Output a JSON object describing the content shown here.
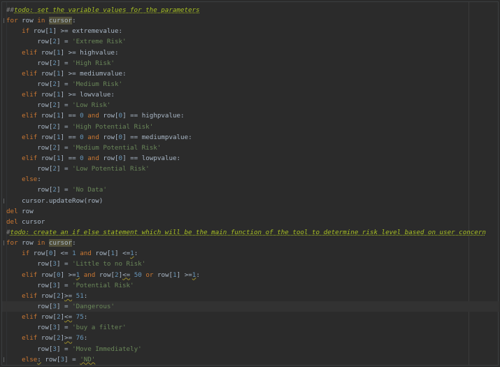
{
  "editor": {
    "lines": [
      [
        [
          "cmt",
          "##"
        ],
        [
          "todo",
          "todo: set the variable values for the parameters"
        ]
      ],
      [
        [
          "kw",
          "for "
        ],
        [
          "id",
          "row "
        ],
        [
          "kw",
          "in "
        ],
        [
          "hl",
          "cursor"
        ],
        [
          "id",
          ":"
        ]
      ],
      [
        [
          "id",
          "    "
        ],
        [
          "kw",
          "if "
        ],
        [
          "id",
          "row["
        ],
        [
          "num",
          "1"
        ],
        [
          "id",
          "] >= extremevalue:"
        ]
      ],
      [
        [
          "id",
          "        row["
        ],
        [
          "num",
          "2"
        ],
        [
          "id",
          "] = "
        ],
        [
          "str",
          "'Extreme Risk'"
        ]
      ],
      [
        [
          "id",
          "    "
        ],
        [
          "kw",
          "elif "
        ],
        [
          "id",
          "row["
        ],
        [
          "num",
          "1"
        ],
        [
          "id",
          "] >= highvalue:"
        ]
      ],
      [
        [
          "id",
          "        row["
        ],
        [
          "num",
          "2"
        ],
        [
          "id",
          "] = "
        ],
        [
          "str",
          "'High Risk'"
        ]
      ],
      [
        [
          "id",
          "    "
        ],
        [
          "kw",
          "elif "
        ],
        [
          "id",
          "row["
        ],
        [
          "num",
          "1"
        ],
        [
          "id",
          "] >= mediumvalue:"
        ]
      ],
      [
        [
          "id",
          "        row["
        ],
        [
          "num",
          "2"
        ],
        [
          "id",
          "] = "
        ],
        [
          "str",
          "'Medium Risk'"
        ]
      ],
      [
        [
          "id",
          "    "
        ],
        [
          "kw",
          "elif "
        ],
        [
          "id",
          "row["
        ],
        [
          "num",
          "1"
        ],
        [
          "id",
          "] >= lowvalue:"
        ]
      ],
      [
        [
          "id",
          "        row["
        ],
        [
          "num",
          "2"
        ],
        [
          "id",
          "] = "
        ],
        [
          "str",
          "'Low Risk'"
        ]
      ],
      [
        [
          "id",
          "    "
        ],
        [
          "kw",
          "elif "
        ],
        [
          "id",
          "row["
        ],
        [
          "num",
          "1"
        ],
        [
          "id",
          "] == "
        ],
        [
          "num",
          "0 "
        ],
        [
          "kw",
          "and "
        ],
        [
          "id",
          "row["
        ],
        [
          "num",
          "0"
        ],
        [
          "id",
          "] == highpvalue:"
        ]
      ],
      [
        [
          "id",
          "        row["
        ],
        [
          "num",
          "2"
        ],
        [
          "id",
          "] = "
        ],
        [
          "str",
          "'High Potential Risk'"
        ]
      ],
      [
        [
          "id",
          "    "
        ],
        [
          "kw",
          "elif "
        ],
        [
          "id",
          "row["
        ],
        [
          "num",
          "1"
        ],
        [
          "id",
          "] == "
        ],
        [
          "num",
          "0 "
        ],
        [
          "kw",
          "and "
        ],
        [
          "id",
          "row["
        ],
        [
          "num",
          "0"
        ],
        [
          "id",
          "] == mediumpvalue:"
        ]
      ],
      [
        [
          "id",
          "        row["
        ],
        [
          "num",
          "2"
        ],
        [
          "id",
          "] = "
        ],
        [
          "str",
          "'Medium Potential Risk'"
        ]
      ],
      [
        [
          "id",
          "    "
        ],
        [
          "kw",
          "elif "
        ],
        [
          "id",
          "row["
        ],
        [
          "num",
          "1"
        ],
        [
          "id",
          "] == "
        ],
        [
          "num",
          "0 "
        ],
        [
          "kw",
          "and "
        ],
        [
          "id",
          "row["
        ],
        [
          "num",
          "0"
        ],
        [
          "id",
          "] == lowpvalue:"
        ]
      ],
      [
        [
          "id",
          "        row["
        ],
        [
          "num",
          "2"
        ],
        [
          "id",
          "] = "
        ],
        [
          "str",
          "'Low Potential Risk'"
        ]
      ],
      [
        [
          "id",
          "    "
        ],
        [
          "kw",
          "else"
        ],
        [
          "id",
          ":"
        ]
      ],
      [
        [
          "id",
          "        row["
        ],
        [
          "num",
          "2"
        ],
        [
          "id",
          "] = "
        ],
        [
          "str",
          "'No Data'"
        ]
      ],
      [
        [
          "id",
          "    cursor.updateRow(row)"
        ]
      ],
      [
        [
          "kw",
          "del "
        ],
        [
          "id",
          "row"
        ]
      ],
      [
        [
          "kw",
          "del "
        ],
        [
          "id",
          "cursor"
        ]
      ],
      [
        [
          "cmt",
          "#"
        ],
        [
          "todo",
          "todo: create an if else statement which will be the main function of the tool to determine risk level based on user concern"
        ]
      ],
      [
        [
          "kw",
          "for "
        ],
        [
          "id",
          "row "
        ],
        [
          "kw",
          "in "
        ],
        [
          "hl",
          "cursor"
        ],
        [
          "id",
          ":"
        ]
      ],
      [
        [
          "id",
          "    "
        ],
        [
          "kw",
          "if "
        ],
        [
          "id",
          "row["
        ],
        [
          "num",
          "0"
        ],
        [
          "id",
          "] <= "
        ],
        [
          "num",
          "1 "
        ],
        [
          "kw",
          "and "
        ],
        [
          "id",
          "row["
        ],
        [
          "num",
          "1"
        ],
        [
          "id",
          "] <="
        ],
        [
          "numw",
          "1"
        ],
        [
          "id",
          ":"
        ]
      ],
      [
        [
          "id",
          "        row["
        ],
        [
          "num",
          "3"
        ],
        [
          "id",
          "] = "
        ],
        [
          "str",
          "'Little to no Risk'"
        ]
      ],
      [
        [
          "id",
          "    "
        ],
        [
          "kw",
          "elif "
        ],
        [
          "id",
          "row["
        ],
        [
          "num",
          "0"
        ],
        [
          "id",
          "] >="
        ],
        [
          "numw",
          "1"
        ],
        [
          "id",
          " "
        ],
        [
          "kw",
          "and "
        ],
        [
          "id",
          "row["
        ],
        [
          "num",
          "2"
        ],
        [
          "id",
          "]"
        ],
        [
          "wavy",
          "<="
        ],
        [
          "id",
          " "
        ],
        [
          "num",
          "50 "
        ],
        [
          "kw",
          "or "
        ],
        [
          "id",
          "row["
        ],
        [
          "num",
          "1"
        ],
        [
          "id",
          "] >="
        ],
        [
          "numw",
          "1"
        ],
        [
          "id",
          ":"
        ]
      ],
      [
        [
          "id",
          "        row["
        ],
        [
          "num",
          "3"
        ],
        [
          "id",
          "] = "
        ],
        [
          "str",
          "'Potential Risk'"
        ]
      ],
      [
        [
          "id",
          "    "
        ],
        [
          "kw",
          "elif "
        ],
        [
          "id",
          "row["
        ],
        [
          "num",
          "2"
        ],
        [
          "id",
          "]"
        ],
        [
          "wavy",
          ">="
        ],
        [
          "id",
          " "
        ],
        [
          "num",
          "51"
        ],
        [
          "id",
          ":"
        ]
      ],
      [
        [
          "id",
          "        row["
        ],
        [
          "num",
          "3"
        ],
        [
          "id",
          "] = "
        ],
        [
          "str",
          "'Dangerous'"
        ]
      ],
      [
        [
          "id",
          "    "
        ],
        [
          "kw",
          "elif "
        ],
        [
          "id",
          "row["
        ],
        [
          "num",
          "2"
        ],
        [
          "id",
          "]"
        ],
        [
          "wavy",
          "<="
        ],
        [
          "id",
          " "
        ],
        [
          "num",
          "75"
        ],
        [
          "id",
          ":"
        ]
      ],
      [
        [
          "id",
          "        row["
        ],
        [
          "num",
          "3"
        ],
        [
          "id",
          "] = "
        ],
        [
          "str",
          "'buy a filter'"
        ]
      ],
      [
        [
          "id",
          "    "
        ],
        [
          "kw",
          "elif "
        ],
        [
          "id",
          "row["
        ],
        [
          "num",
          "2"
        ],
        [
          "id",
          "]"
        ],
        [
          "wavy",
          ">="
        ],
        [
          "id",
          " "
        ],
        [
          "num",
          "76"
        ],
        [
          "id",
          ":"
        ]
      ],
      [
        [
          "id",
          "        row["
        ],
        [
          "num",
          "3"
        ],
        [
          "id",
          "] = "
        ],
        [
          "str",
          "'Move Immediately'"
        ]
      ],
      [
        [
          "id",
          "    "
        ],
        [
          "kw",
          "else"
        ],
        [
          "wavy",
          ":"
        ],
        [
          "id",
          " row["
        ],
        [
          "num",
          "3"
        ],
        [
          "id",
          "] = "
        ],
        [
          "strw",
          "'ND'"
        ]
      ]
    ],
    "current_line": 28,
    "fold_lines": [
      1,
      18,
      22,
      33
    ]
  },
  "colors": {
    "background": "#2b2b2b",
    "keyword": "#cc7832",
    "number": "#6897bb",
    "string": "#6a8759",
    "comment": "#808080",
    "todo": "#a8c023",
    "identifier": "#a9b7c6"
  }
}
